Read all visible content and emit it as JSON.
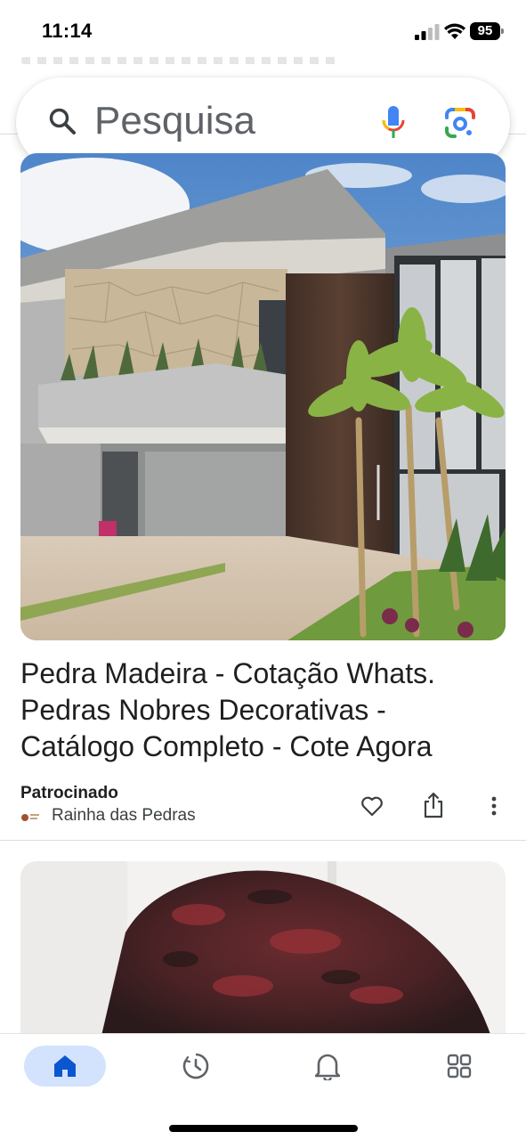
{
  "status_bar": {
    "time": "11:14",
    "battery": "95"
  },
  "search": {
    "placeholder": "Pesquisa"
  },
  "feed": [
    {
      "title_lines": [
        "Pedra Madeira - Cotação Whats.",
        "Pedras Nobres Decorativas -",
        "Catálogo Completo - Cote Agora"
      ],
      "sponsored_label": "Patrocinado",
      "source": "Rainha das Pedras"
    }
  ],
  "bottom_nav": [
    "home",
    "discover",
    "notifications",
    "apps"
  ],
  "colors": {
    "accent": "#1a73e8",
    "nav_active_bg": "#d3e3fd"
  }
}
